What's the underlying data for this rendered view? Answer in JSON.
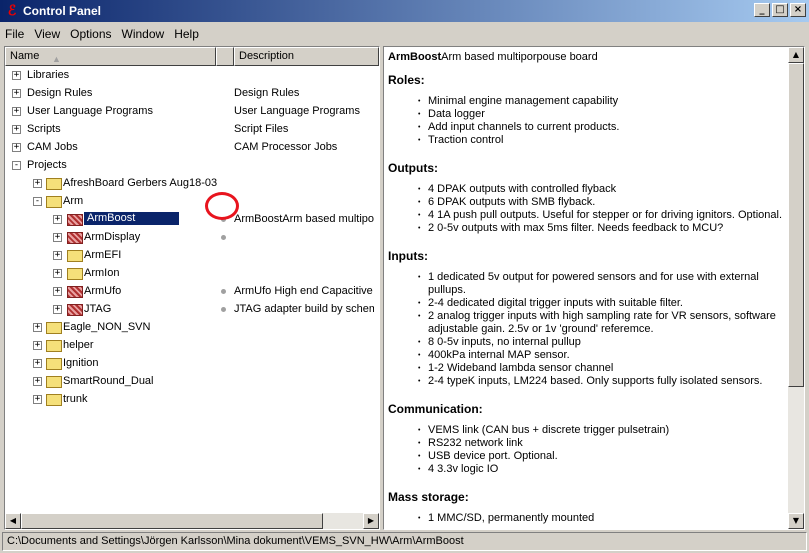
{
  "window": {
    "title": "Control Panel",
    "minimize": "_",
    "maximize": "□",
    "close": "×"
  },
  "menu": [
    "File",
    "View",
    "Options",
    "Window",
    "Help"
  ],
  "tree_header": {
    "name": "Name",
    "description": "Description"
  },
  "tree": [
    {
      "label": "Libraries",
      "desc": "",
      "level": 0,
      "expander": "+",
      "icon": "none",
      "dot": false
    },
    {
      "label": "Design Rules",
      "desc": "Design Rules",
      "level": 0,
      "expander": "+",
      "icon": "none",
      "dot": false
    },
    {
      "label": "User Language Programs",
      "desc": "User Language Programs",
      "level": 0,
      "expander": "+",
      "icon": "none",
      "dot": false
    },
    {
      "label": "Scripts",
      "desc": "Script Files",
      "level": 0,
      "expander": "+",
      "icon": "none",
      "dot": false
    },
    {
      "label": "CAM Jobs",
      "desc": "CAM Processor Jobs",
      "level": 0,
      "expander": "+",
      "icon": "none",
      "dot": false
    },
    {
      "label": "Projects",
      "desc": "",
      "level": 0,
      "expander": "-",
      "icon": "none",
      "dot": false
    },
    {
      "label": "AfreshBoard Gerbers Aug18-03",
      "desc": "",
      "level": 1,
      "expander": "+",
      "icon": "folder",
      "dot": false
    },
    {
      "label": "Arm",
      "desc": "",
      "level": 1,
      "expander": "-",
      "icon": "folder-open",
      "dot": false
    },
    {
      "label": "ArmBoost",
      "desc": "ArmBoostArm based multiporp",
      "level": 2,
      "expander": "+",
      "icon": "project",
      "dot": true,
      "selected": true
    },
    {
      "label": "ArmDisplay",
      "desc": "",
      "level": 2,
      "expander": "+",
      "icon": "project",
      "dot": true
    },
    {
      "label": "ArmEFI",
      "desc": "",
      "level": 2,
      "expander": "+",
      "icon": "folder",
      "dot": false
    },
    {
      "label": "ArmIon",
      "desc": "",
      "level": 2,
      "expander": "+",
      "icon": "folder",
      "dot": false
    },
    {
      "label": "ArmUfo",
      "desc": "ArmUfo High end Capacitive I",
      "level": 2,
      "expander": "+",
      "icon": "project",
      "dot": true
    },
    {
      "label": "JTAG",
      "desc": "JTAG adapter build by schem",
      "level": 2,
      "expander": "+",
      "icon": "project",
      "dot": true
    },
    {
      "label": "Eagle_NON_SVN",
      "desc": "",
      "level": 1,
      "expander": "+",
      "icon": "folder",
      "dot": false
    },
    {
      "label": "helper",
      "desc": "",
      "level": 1,
      "expander": "+",
      "icon": "folder",
      "dot": false
    },
    {
      "label": "Ignition",
      "desc": "",
      "level": 1,
      "expander": "+",
      "icon": "folder",
      "dot": false
    },
    {
      "label": "SmartRound_Dual",
      "desc": "",
      "level": 1,
      "expander": "+",
      "icon": "folder",
      "dot": false
    },
    {
      "label": "trunk",
      "desc": "",
      "level": 1,
      "expander": "+",
      "icon": "folder",
      "dot": false
    }
  ],
  "doc": {
    "title_bold": "ArmBoost",
    "title_rest": "Arm based multiporpouse board",
    "sections": [
      {
        "heading": "Roles:",
        "items": [
          "Minimal engine management capability",
          "Data logger",
          "Add input channels to current products.",
          "Traction control"
        ]
      },
      {
        "heading": "Outputs:",
        "items": [
          "4 DPAK outputs with controlled flyback",
          "6 DPAK outputs with SMB flyback.",
          "4 1A push pull outputs. Useful for stepper or for driving ignitors. Optional.",
          "2 0-5v outputs with max 5ms filter. Needs feedback to MCU?"
        ]
      },
      {
        "heading": "Inputs:",
        "items": [
          "1 dedicated 5v output for powered sensors and for use with external pullups.",
          "2-4 dedicated digital trigger inputs with suitable filter.",
          "2 analog trigger inputs with high sampling rate for VR sensors, software adjustable gain. 2.5v or 1v 'ground' referemce.",
          "8 0-5v inputs, no internal pullup",
          "400kPa internal MAP sensor.",
          "1-2 Wideband lambda sensor channel",
          "2-4 typeK inputs, LM224 based. Only supports fully isolated sensors."
        ]
      },
      {
        "heading": "Communication:",
        "items": [
          "VEMS link (CAN bus + discrete trigger pulsetrain)",
          "RS232 network link",
          "USB device port. Optional.",
          "4 3.3v logic IO"
        ]
      },
      {
        "heading": "Mass storage:",
        "items": [
          "1 MMC/SD, permanently mounted"
        ]
      }
    ]
  },
  "status": "C:\\Documents and Settings\\Jörgen Karlsson\\Mina dokument\\VEMS_SVN_HW\\Arm\\ArmBoost",
  "colors": {
    "selection": "#0a246a",
    "annotation_circle": "#e8141e"
  }
}
